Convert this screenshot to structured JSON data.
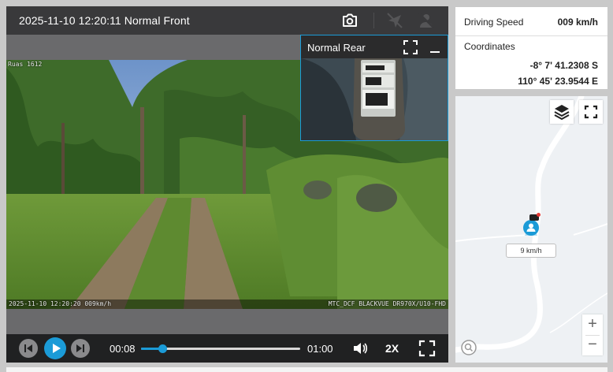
{
  "player": {
    "title": "2025-11-10 12:20:11 Normal Front",
    "osd": {
      "top_left": "Ruas 1612",
      "bottom_left": "2025-11-10 12:20:20 009km/h",
      "bottom_right": "MTC_DCF BLACKVUE DR970X/U10-FHD"
    },
    "rear": {
      "title": "Normal Rear"
    },
    "controls": {
      "time_current": "00:08",
      "time_total": "01:00",
      "progress": 0.133,
      "speed_label": "2X"
    }
  },
  "info": {
    "speed_label": "Driving Speed",
    "speed_value": "009 km/h",
    "coordinates_label": "Coordinates",
    "latitude": "-8° 7' 41.2308 S",
    "longitude": "110° 45' 23.9544 E"
  },
  "map": {
    "speed_tag": "9 km/h",
    "zoom_in": "+",
    "zoom_out": "−"
  },
  "colors": {
    "accent": "#1b9bd7",
    "player_bg": "#3a3a3c",
    "controls_bg": "#202122",
    "map_bg": "#eef1f4"
  },
  "icons": {
    "top": [
      "camera-icon",
      "nav-disabled-icon",
      "person-disabled-icon"
    ],
    "rear": [
      "expand-icon",
      "minimize-icon"
    ],
    "controls": [
      "prev-icon",
      "play-icon",
      "next-icon",
      "volume-icon",
      "fullscreen-icon"
    ],
    "map": [
      "layers-icon",
      "map-fullscreen-icon",
      "vehicle-icon",
      "map-logo-icon"
    ]
  }
}
